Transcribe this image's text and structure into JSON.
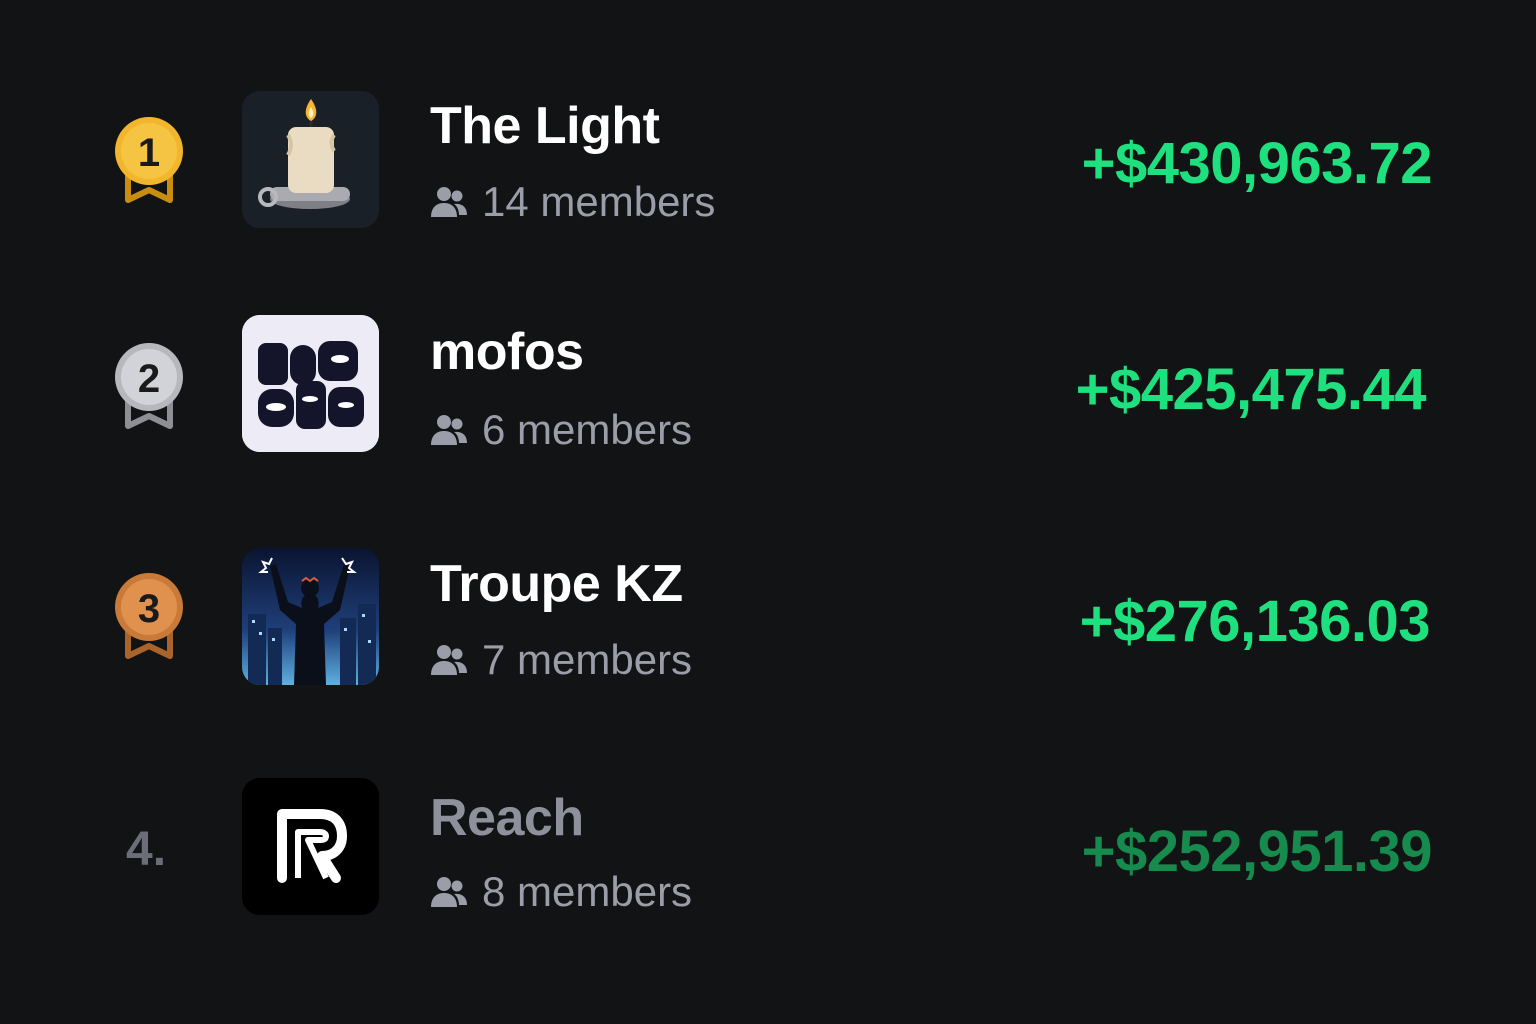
{
  "leaderboard": {
    "rows": [
      {
        "rank": "1",
        "name": "The Light",
        "members": "14 members",
        "amount": "+$430,963.72",
        "medal": "gold",
        "avatar": "candle"
      },
      {
        "rank": "2",
        "name": "mofos",
        "members": "6 members",
        "amount": "+$425,475.44",
        "medal": "silver",
        "avatar": "mofos-logo"
      },
      {
        "rank": "3",
        "name": "Troupe KZ",
        "members": "7 members",
        "amount": "+$276,136.03",
        "medal": "bronze",
        "avatar": "night-city-figure"
      },
      {
        "rank": "4.",
        "name": "Reach",
        "members": "8 members",
        "amount": "+$252,951.39",
        "medal": "none",
        "avatar": "reach-logo"
      }
    ]
  },
  "colors": {
    "background": "#121315",
    "positive": "#1fe07e",
    "positive_dim": "#178a4e",
    "muted_text": "#9b9da9",
    "gold": "#f0b52c",
    "silver": "#c5c6cb",
    "bronze": "#d98a44"
  }
}
